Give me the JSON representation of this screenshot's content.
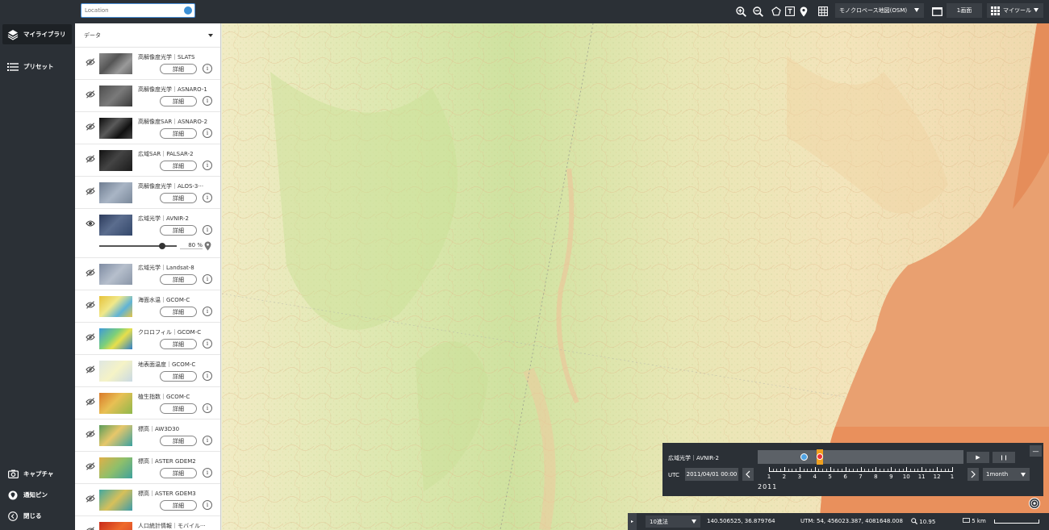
{
  "nav": {
    "my_library": "マイライブラリ",
    "presets": "プリセット",
    "capture": "キャプチャ",
    "notify_pin": "通知ピン",
    "close": "閉じる"
  },
  "topbar": {
    "search_placeholder": "Location",
    "basemap": "モノクロベース地図(OSM)",
    "screen": "1画面",
    "mytool": "マイツール"
  },
  "panel": {
    "header": "データ",
    "detail_label": "詳細",
    "info_label": "i",
    "layers": [
      {
        "name": "高解像度光学｜SLATS",
        "visible": false
      },
      {
        "name": "高解像度光学｜ASNARO-1",
        "visible": false
      },
      {
        "name": "高解像度SAR｜ASNARO-2",
        "visible": false
      },
      {
        "name": "広域SAR｜PALSAR-2",
        "visible": false
      },
      {
        "name": "高解像度光学｜ALOS-3···",
        "visible": false
      },
      {
        "name": "広域光学｜AVNIR-2",
        "visible": true,
        "opacity": "80",
        "opacity_unit": "%"
      },
      {
        "name": "広域光学｜Landsat-8",
        "visible": false
      },
      {
        "name": "海面水温｜GCOM-C",
        "visible": false
      },
      {
        "name": "クロロフィル｜GCOM-C",
        "visible": false
      },
      {
        "name": "地表面温度｜GCOM-C",
        "visible": false
      },
      {
        "name": "植生指数｜GCOM-C",
        "visible": false
      },
      {
        "name": "標高｜AW3D30",
        "visible": false
      },
      {
        "name": "標高｜ASTER GDEM2",
        "visible": false
      },
      {
        "name": "標高｜ASTER GDEM3",
        "visible": false
      },
      {
        "name": "人口統計情報｜モバイル···",
        "visible": false
      }
    ]
  },
  "timeline": {
    "layer": "広域光学｜AVNIR-2",
    "utc_label": "UTC",
    "date": "2011/04/01 00:00",
    "play": "▶",
    "pause": "❙❙",
    "minimize": "—",
    "months": [
      "1",
      "2",
      "3",
      "4",
      "5",
      "6",
      "7",
      "8",
      "9",
      "10",
      "11",
      "12",
      "1"
    ],
    "year": "2011",
    "interval": "1month"
  },
  "statusbar": {
    "toggle": "▸",
    "format": "10進法",
    "coords": "140.506525, 36.879764",
    "utm": "UTM: 54, 456023.387, 4081648.008",
    "zoom": "10.95",
    "scale": "5 km"
  },
  "colors": {
    "dark": "#2b3036",
    "accent": "#3a8fd6",
    "ocean": "#e78f5b",
    "land": "#f2e7bd"
  }
}
